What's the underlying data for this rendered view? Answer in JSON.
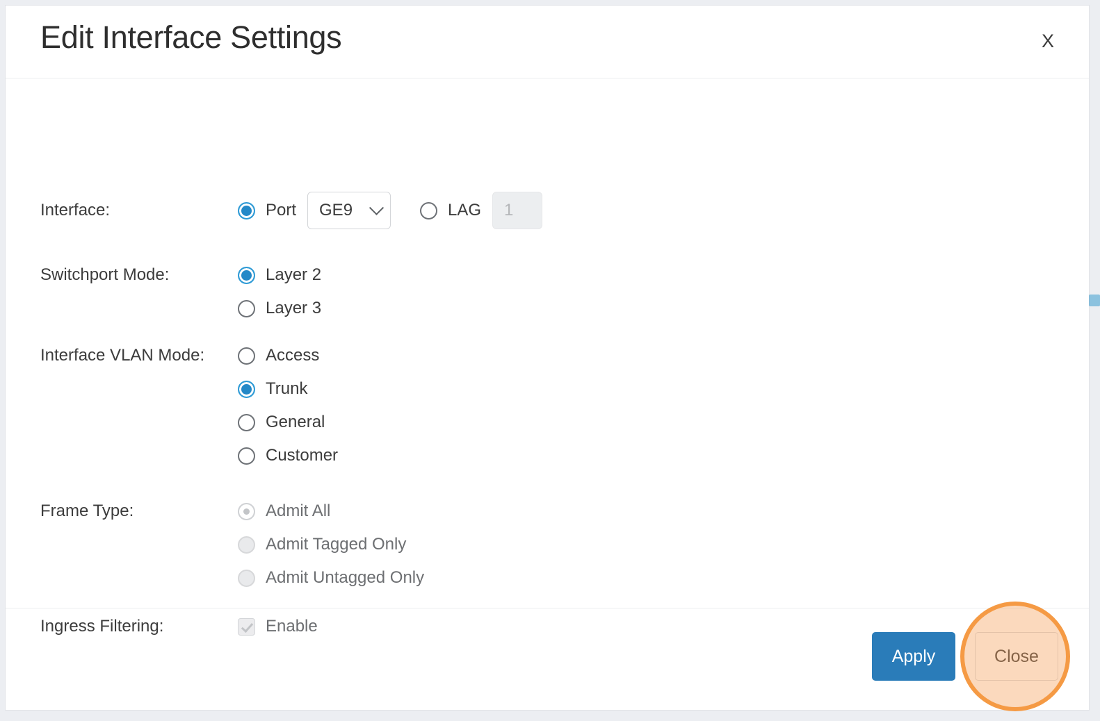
{
  "dialog": {
    "title": "Edit Interface Settings",
    "close_icon": "close-x-icon"
  },
  "form": {
    "interface": {
      "label": "Interface:",
      "port_option": "Port",
      "port_selected": true,
      "port_select_value": "GE9",
      "port_select_chevron": "chevron-down-icon",
      "lag_option": "LAG",
      "lag_selected": false,
      "lag_value": "1",
      "lag_disabled": true
    },
    "switchport_mode": {
      "label": "Switchport Mode:",
      "options": [
        {
          "label": "Layer 2",
          "selected": true
        },
        {
          "label": "Layer 3",
          "selected": false
        }
      ]
    },
    "interface_vlan_mode": {
      "label": "Interface VLAN Mode:",
      "options": [
        {
          "label": "Access",
          "selected": false
        },
        {
          "label": "Trunk",
          "selected": true
        },
        {
          "label": "General",
          "selected": false
        },
        {
          "label": "Customer",
          "selected": false
        }
      ]
    },
    "frame_type": {
      "label": "Frame Type:",
      "disabled": true,
      "options": [
        {
          "label": "Admit All",
          "selected": true
        },
        {
          "label": "Admit Tagged Only",
          "selected": false
        },
        {
          "label": "Admit Untagged Only",
          "selected": false
        }
      ]
    },
    "ingress_filtering": {
      "label": "Ingress Filtering:",
      "checkbox_label": "Enable",
      "checked": true,
      "disabled": true
    }
  },
  "footer": {
    "apply_label": "Apply",
    "close_label": "Close"
  },
  "colors": {
    "accent_blue": "#2489c8",
    "apply_button": "#2a7cb9",
    "radio_selected_ring": "#2e9bd6",
    "highlight_ring": "#f59a44",
    "highlight_fill": "rgba(246,161,90,0.40)",
    "page_background": "#eceef2",
    "dialog_background": "#ffffff",
    "text": "#3c3c3c",
    "disabled_text": "#b4b6b9"
  }
}
